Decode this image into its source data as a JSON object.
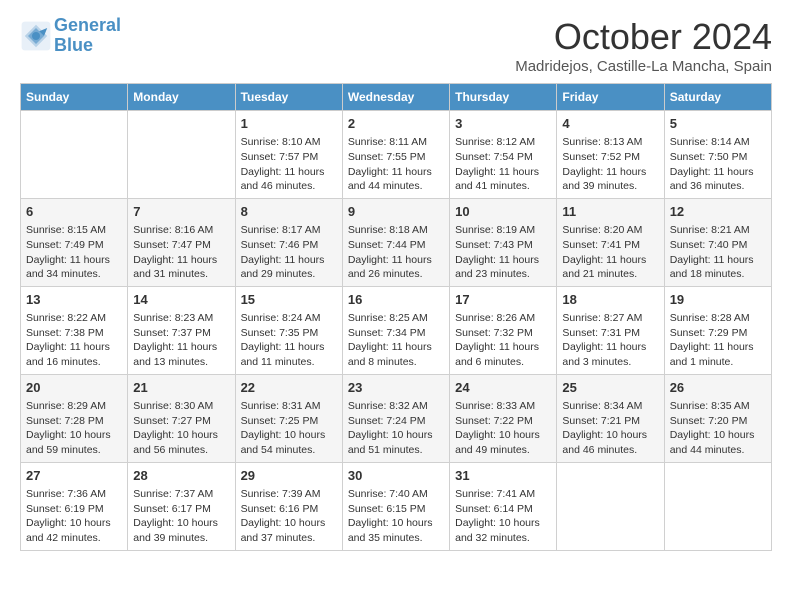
{
  "header": {
    "logo_line1": "General",
    "logo_line2": "Blue",
    "month": "October 2024",
    "location": "Madridejos, Castille-La Mancha, Spain"
  },
  "days_of_week": [
    "Sunday",
    "Monday",
    "Tuesday",
    "Wednesday",
    "Thursday",
    "Friday",
    "Saturday"
  ],
  "weeks": [
    [
      {
        "day": "",
        "content": ""
      },
      {
        "day": "",
        "content": ""
      },
      {
        "day": "1",
        "content": "Sunrise: 8:10 AM\nSunset: 7:57 PM\nDaylight: 11 hours and 46 minutes."
      },
      {
        "day": "2",
        "content": "Sunrise: 8:11 AM\nSunset: 7:55 PM\nDaylight: 11 hours and 44 minutes."
      },
      {
        "day": "3",
        "content": "Sunrise: 8:12 AM\nSunset: 7:54 PM\nDaylight: 11 hours and 41 minutes."
      },
      {
        "day": "4",
        "content": "Sunrise: 8:13 AM\nSunset: 7:52 PM\nDaylight: 11 hours and 39 minutes."
      },
      {
        "day": "5",
        "content": "Sunrise: 8:14 AM\nSunset: 7:50 PM\nDaylight: 11 hours and 36 minutes."
      }
    ],
    [
      {
        "day": "6",
        "content": "Sunrise: 8:15 AM\nSunset: 7:49 PM\nDaylight: 11 hours and 34 minutes."
      },
      {
        "day": "7",
        "content": "Sunrise: 8:16 AM\nSunset: 7:47 PM\nDaylight: 11 hours and 31 minutes."
      },
      {
        "day": "8",
        "content": "Sunrise: 8:17 AM\nSunset: 7:46 PM\nDaylight: 11 hours and 29 minutes."
      },
      {
        "day": "9",
        "content": "Sunrise: 8:18 AM\nSunset: 7:44 PM\nDaylight: 11 hours and 26 minutes."
      },
      {
        "day": "10",
        "content": "Sunrise: 8:19 AM\nSunset: 7:43 PM\nDaylight: 11 hours and 23 minutes."
      },
      {
        "day": "11",
        "content": "Sunrise: 8:20 AM\nSunset: 7:41 PM\nDaylight: 11 hours and 21 minutes."
      },
      {
        "day": "12",
        "content": "Sunrise: 8:21 AM\nSunset: 7:40 PM\nDaylight: 11 hours and 18 minutes."
      }
    ],
    [
      {
        "day": "13",
        "content": "Sunrise: 8:22 AM\nSunset: 7:38 PM\nDaylight: 11 hours and 16 minutes."
      },
      {
        "day": "14",
        "content": "Sunrise: 8:23 AM\nSunset: 7:37 PM\nDaylight: 11 hours and 13 minutes."
      },
      {
        "day": "15",
        "content": "Sunrise: 8:24 AM\nSunset: 7:35 PM\nDaylight: 11 hours and 11 minutes."
      },
      {
        "day": "16",
        "content": "Sunrise: 8:25 AM\nSunset: 7:34 PM\nDaylight: 11 hours and 8 minutes."
      },
      {
        "day": "17",
        "content": "Sunrise: 8:26 AM\nSunset: 7:32 PM\nDaylight: 11 hours and 6 minutes."
      },
      {
        "day": "18",
        "content": "Sunrise: 8:27 AM\nSunset: 7:31 PM\nDaylight: 11 hours and 3 minutes."
      },
      {
        "day": "19",
        "content": "Sunrise: 8:28 AM\nSunset: 7:29 PM\nDaylight: 11 hours and 1 minute."
      }
    ],
    [
      {
        "day": "20",
        "content": "Sunrise: 8:29 AM\nSunset: 7:28 PM\nDaylight: 10 hours and 59 minutes."
      },
      {
        "day": "21",
        "content": "Sunrise: 8:30 AM\nSunset: 7:27 PM\nDaylight: 10 hours and 56 minutes."
      },
      {
        "day": "22",
        "content": "Sunrise: 8:31 AM\nSunset: 7:25 PM\nDaylight: 10 hours and 54 minutes."
      },
      {
        "day": "23",
        "content": "Sunrise: 8:32 AM\nSunset: 7:24 PM\nDaylight: 10 hours and 51 minutes."
      },
      {
        "day": "24",
        "content": "Sunrise: 8:33 AM\nSunset: 7:22 PM\nDaylight: 10 hours and 49 minutes."
      },
      {
        "day": "25",
        "content": "Sunrise: 8:34 AM\nSunset: 7:21 PM\nDaylight: 10 hours and 46 minutes."
      },
      {
        "day": "26",
        "content": "Sunrise: 8:35 AM\nSunset: 7:20 PM\nDaylight: 10 hours and 44 minutes."
      }
    ],
    [
      {
        "day": "27",
        "content": "Sunrise: 7:36 AM\nSunset: 6:19 PM\nDaylight: 10 hours and 42 minutes."
      },
      {
        "day": "28",
        "content": "Sunrise: 7:37 AM\nSunset: 6:17 PM\nDaylight: 10 hours and 39 minutes."
      },
      {
        "day": "29",
        "content": "Sunrise: 7:39 AM\nSunset: 6:16 PM\nDaylight: 10 hours and 37 minutes."
      },
      {
        "day": "30",
        "content": "Sunrise: 7:40 AM\nSunset: 6:15 PM\nDaylight: 10 hours and 35 minutes."
      },
      {
        "day": "31",
        "content": "Sunrise: 7:41 AM\nSunset: 6:14 PM\nDaylight: 10 hours and 32 minutes."
      },
      {
        "day": "",
        "content": ""
      },
      {
        "day": "",
        "content": ""
      }
    ]
  ]
}
